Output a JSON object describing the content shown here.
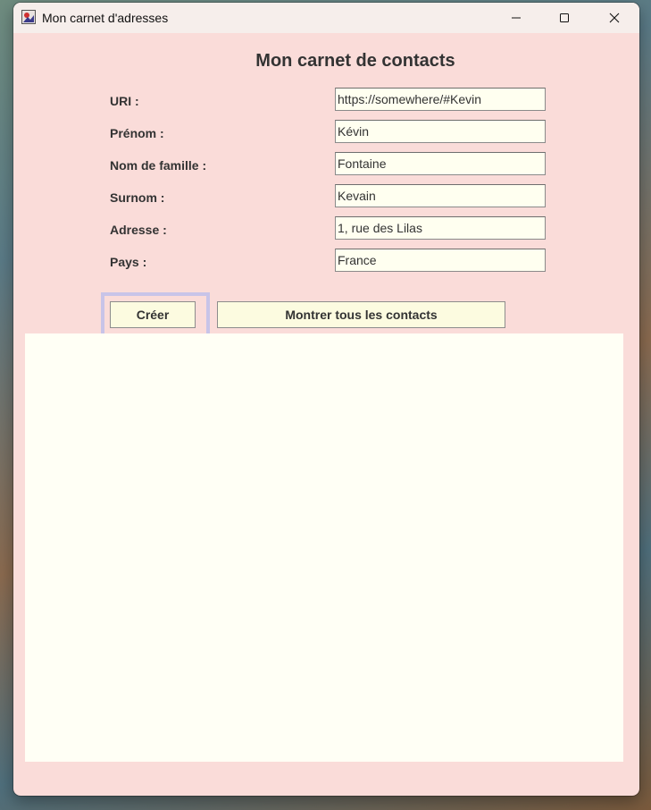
{
  "window": {
    "title": "Mon carnet d'adresses"
  },
  "form": {
    "heading": "Mon carnet de contacts",
    "fields": [
      {
        "label": "URI :",
        "value": "https://somewhere/#Kevin"
      },
      {
        "label": "Prénom :",
        "value": "Kévin"
      },
      {
        "label": "Nom de famille :",
        "value": "Fontaine"
      },
      {
        "label": "Surnom :",
        "value": "Kevain"
      },
      {
        "label": "Adresse :",
        "value": "1, rue des Lilas"
      },
      {
        "label": "Pays :",
        "value": "France"
      }
    ]
  },
  "buttons": {
    "create_label": "Créer",
    "show_all_label": "Montrer tous les contacts"
  },
  "colors": {
    "window_bg": "#fadcd9",
    "field_bg": "#fffff0",
    "button_bg": "#fcfbe0",
    "focus_ring": "#c8c4e8",
    "output_bg": "#fffff5"
  }
}
